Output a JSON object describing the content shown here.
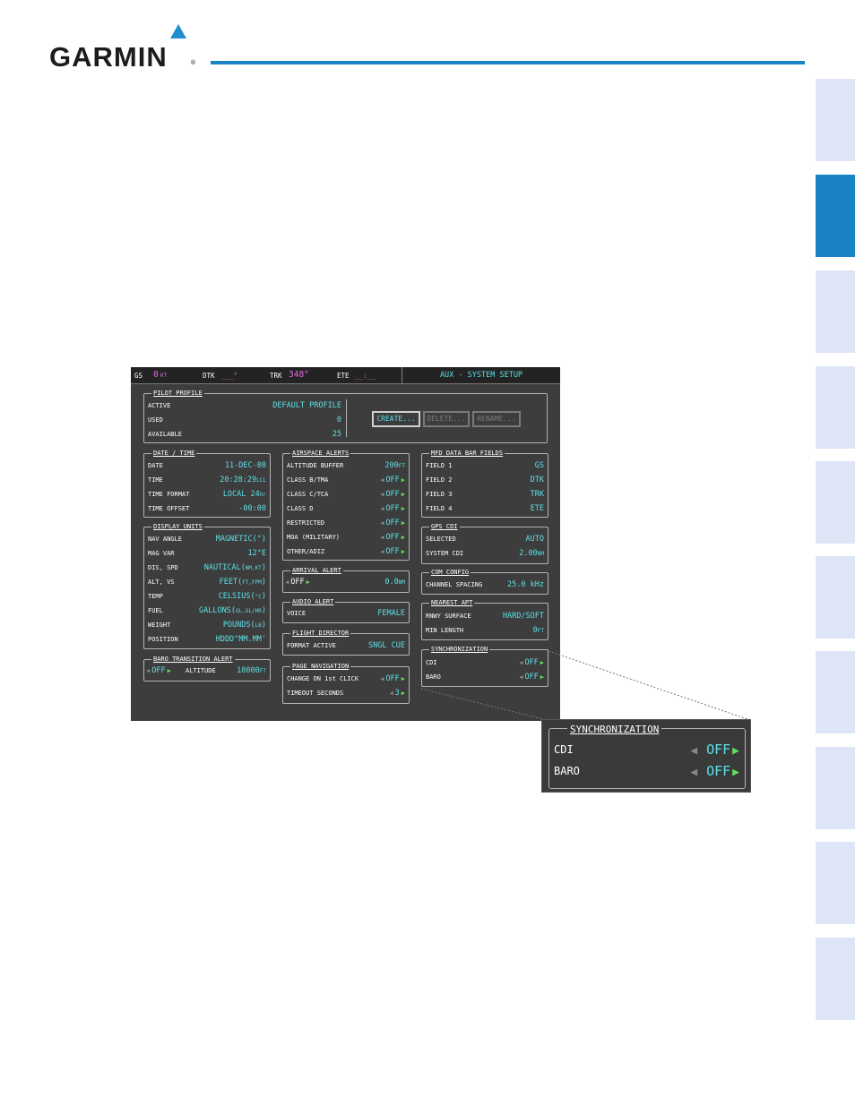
{
  "header": {
    "brand": "GARMIN",
    "trademark": "®"
  },
  "mfd": {
    "topbar": {
      "gs_label": "GS",
      "gs_value": "0",
      "gs_unit": "KT",
      "dtk_label": "DTK",
      "dtk_value": "___°",
      "trk_label": "TRK",
      "trk_value": "348°",
      "ete_label": "ETE",
      "ete_value": "__:__"
    },
    "page_title": "AUX - SYSTEM SETUP",
    "pilot_profile": {
      "title": "PILOT PROFILE",
      "active_label": "ACTIVE",
      "active_value": "DEFAULT PROFILE",
      "used_label": "USED",
      "used_value": "0",
      "available_label": "AVAILABLE",
      "available_value": "25",
      "create": "CREATE...",
      "delete": "DELETE...",
      "rename": "RENAME..."
    },
    "date_time": {
      "title": "DATE / TIME",
      "rows": [
        {
          "label": "DATE",
          "value": "11-DEC-08",
          "unit": ""
        },
        {
          "label": "TIME",
          "value": "20:28:29",
          "unit": "LCL"
        },
        {
          "label": "TIME FORMAT",
          "value": "LOCAL 24",
          "unit": "hr"
        },
        {
          "label": "TIME OFFSET",
          "value": "-00:00",
          "unit": ""
        }
      ]
    },
    "display_units": {
      "title": "DISPLAY UNITS",
      "rows": [
        {
          "label": "NAV ANGLE",
          "value": "MAGNETIC(°)",
          "unit": ""
        },
        {
          "label": "MAG VAR",
          "value": "12°E",
          "unit": ""
        },
        {
          "label": "DIS, SPD",
          "value": "NAUTICAL(",
          "unit": "NM,KT",
          "close": ")"
        },
        {
          "label": "ALT, VS",
          "value": "FEET(",
          "unit": "FT,FPM",
          "close": ")"
        },
        {
          "label": "TEMP",
          "value": "CELSIUS(",
          "unit": "°C",
          "close": ")"
        },
        {
          "label": "FUEL",
          "value": "GALLONS(",
          "unit": "GL,GL/HR",
          "close": ")"
        },
        {
          "label": "WEIGHT",
          "value": "POUNDS(",
          "unit": "LB",
          "close": ")"
        },
        {
          "label": "POSITION",
          "value": "HDDD°MM.MM'",
          "unit": ""
        }
      ]
    },
    "baro_transition": {
      "title": "BARO TRANSITION ALERT",
      "state": "OFF",
      "altitude_label": "ALTITUDE",
      "altitude_value": "18000",
      "altitude_unit": "FT"
    },
    "airspace_alerts": {
      "title": "AIRSPACE ALERTS",
      "buffer_label": "ALTITUDE BUFFER",
      "buffer_value": "200",
      "buffer_unit": "FT",
      "rows": [
        {
          "label": "CLASS B/TMA",
          "value": "OFF"
        },
        {
          "label": "CLASS C/TCA",
          "value": "OFF"
        },
        {
          "label": "CLASS D",
          "value": "OFF"
        },
        {
          "label": "RESTRICTED",
          "value": "OFF"
        },
        {
          "label": "MOA (MILITARY)",
          "value": "OFF"
        },
        {
          "label": "OTHER/ADIZ",
          "value": "OFF"
        }
      ]
    },
    "arrival_alert": {
      "title": "ARRIVAL ALERT",
      "state": "OFF",
      "distance": "0.0",
      "unit": "NM"
    },
    "audio_alert": {
      "title": "AUDIO ALERT",
      "voice_label": "VOICE",
      "voice_value": "FEMALE"
    },
    "flight_director": {
      "title": "FLIGHT DIRECTOR",
      "format_label": "FORMAT ACTIVE",
      "format_value": "SNGL CUE"
    },
    "page_navigation": {
      "title": "PAGE NAVIGATION",
      "change_label": "CHANGE ON 1st CLICK",
      "change_value": "OFF",
      "timeout_label": "TIMEOUT SECONDS",
      "timeout_value": "3"
    },
    "mfd_data_bar": {
      "title": "MFD DATA BAR FIELDS",
      "rows": [
        {
          "label": "FIELD 1",
          "value": "GS"
        },
        {
          "label": "FIELD 2",
          "value": "DTK"
        },
        {
          "label": "FIELD 3",
          "value": "TRK"
        },
        {
          "label": "FIELD 4",
          "value": "ETE"
        }
      ]
    },
    "gps_cdi": {
      "title": "GPS CDI",
      "selected_label": "SELECTED",
      "selected_value": "AUTO",
      "system_label": "SYSTEM CDI",
      "system_value": "2.00",
      "system_unit": "NM"
    },
    "com_config": {
      "title": "COM CONFIG",
      "spacing_label": "CHANNEL SPACING",
      "spacing_value": "25.0 kHz"
    },
    "nearest_apt": {
      "title": "NEAREST APT",
      "surface_label": "RNWY SURFACE",
      "surface_value": "HARD/SOFT",
      "length_label": "MIN LENGTH",
      "length_value": "0",
      "length_unit": "FT"
    },
    "synchronization": {
      "title": "SYNCHRONIZATION",
      "cdi_label": "CDI",
      "cdi_value": "OFF",
      "baro_label": "BARO",
      "baro_value": "OFF"
    }
  },
  "inset": {
    "title": "SYNCHRONIZATION",
    "cdi_label": "CDI",
    "cdi_value": "OFF",
    "baro_label": "BARO",
    "baro_value": "OFF"
  },
  "colors": {
    "accent_blue": "#1a83c6",
    "tab_inactive": "#dde5f6",
    "mfd_cyan": "#5de0e6",
    "mfd_magenta": "#e468e6",
    "mfd_green": "#5fe05a"
  }
}
